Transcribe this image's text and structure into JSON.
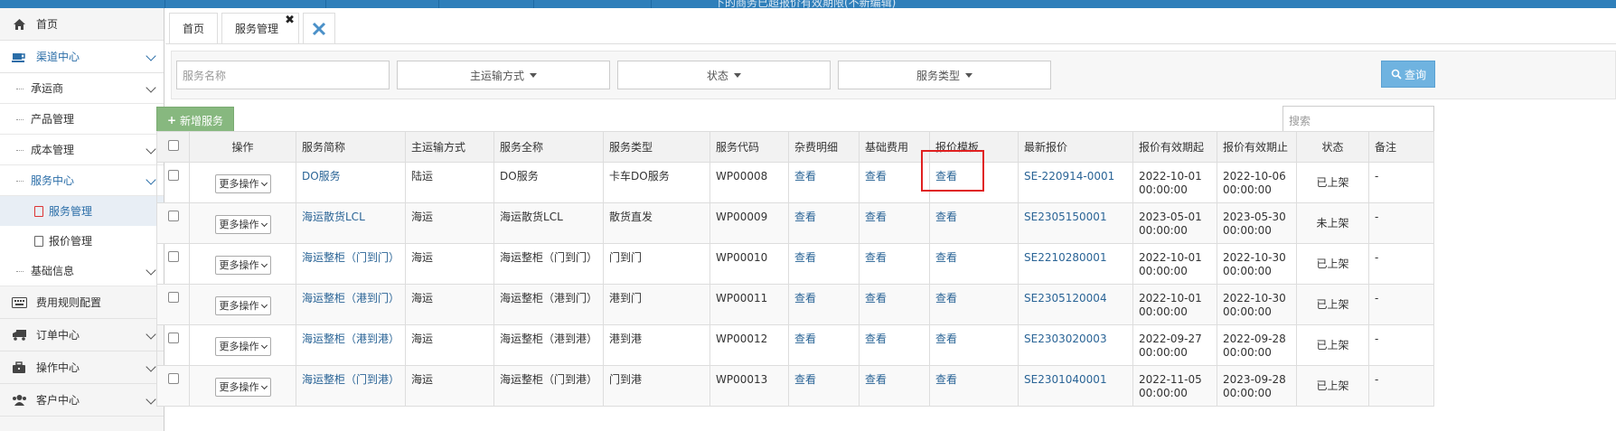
{
  "topbar": {
    "title_fragment": "下的商务已超报价有效期限(不新编辑)"
  },
  "sidebar": {
    "home": "首页",
    "channel_center": "渠道中心",
    "carrier": "承运商",
    "product_mgmt": "产品管理",
    "cost_mgmt": "成本管理",
    "service_center": "服务中心",
    "service_mgmt": "服务管理",
    "quote_mgmt": "报价管理",
    "base_info": "基础信息",
    "fee_rules": "费用规则配置",
    "order_center": "订单中心",
    "ops_center": "操作中心",
    "customer_center": "客户中心"
  },
  "tabs": {
    "home": "首页",
    "service_mgmt": "服务管理",
    "close": "✖"
  },
  "filters": {
    "name_placeholder": "服务名称",
    "transport": "主运输方式",
    "status": "状态",
    "service_type": "服务类型",
    "query_btn": "查询"
  },
  "toolbar": {
    "add_btn": "新增服务",
    "search_placeholder": "搜索"
  },
  "table": {
    "headers": [
      "操作",
      "服务简称",
      "主运输方式",
      "服务全称",
      "服务类型",
      "服务代码",
      "杂费明细",
      "基础费用",
      "报价模板",
      "最新报价",
      "报价有效期起",
      "报价有效期止",
      "状态",
      "备注"
    ],
    "more_ops": "更多操作",
    "view": "查看",
    "rows": [
      {
        "short": "DO服务",
        "transport": "陆运",
        "full": "DO服务",
        "type": "卡车DO服务",
        "code": "WP00008",
        "quote": "SE-220914-0001",
        "from_d": "2022-10-01",
        "from_t": "00:00:00",
        "to_d": "2022-10-06",
        "to_t": "00:00:00",
        "status": "已上架",
        "remark": "-"
      },
      {
        "short": "海运散货LCL",
        "transport": "海运",
        "full": "海运散货LCL",
        "type": "散货直发",
        "code": "WP00009",
        "quote": "SE2305150001",
        "from_d": "2023-05-01",
        "from_t": "00:00:00",
        "to_d": "2023-05-30",
        "to_t": "00:00:00",
        "status": "未上架",
        "remark": "-"
      },
      {
        "short": "海运整柜（门到门）",
        "transport": "海运",
        "full": "海运整柜（门到门）",
        "type": "门到门",
        "code": "WP00010",
        "quote": "SE2210280001",
        "from_d": "2022-10-01",
        "from_t": "00:00:00",
        "to_d": "2022-10-30",
        "to_t": "00:00:00",
        "status": "已上架",
        "remark": "-"
      },
      {
        "short": "海运整柜（港到门）",
        "transport": "海运",
        "full": "海运整柜（港到门）",
        "type": "港到门",
        "code": "WP00011",
        "quote": "SE2305120004",
        "from_d": "2022-10-01",
        "from_t": "00:00:00",
        "to_d": "2022-10-30",
        "to_t": "00:00:00",
        "status": "已上架",
        "remark": "-"
      },
      {
        "short": "海运整柜（港到港）",
        "transport": "海运",
        "full": "海运整柜（港到港）",
        "type": "港到港",
        "code": "WP00012",
        "quote": "SE2303020003",
        "from_d": "2022-09-27",
        "from_t": "00:00:00",
        "to_d": "2022-09-28",
        "to_t": "00:00:00",
        "status": "已上架",
        "remark": "-"
      },
      {
        "short": "海运整柜（门到港）",
        "transport": "海运",
        "full": "海运整柜（门到港）",
        "type": "门到港",
        "code": "WP00013",
        "quote": "SE2301040001",
        "from_d": "2022-11-05",
        "from_t": "00:00:00",
        "to_d": "2023-09-28",
        "to_t": "00:00:00",
        "status": "已上架",
        "remark": "-"
      }
    ]
  },
  "colors": {
    "primary": "#2f7fba",
    "link": "#2a6496",
    "add_button": "#87b87f",
    "query_button": "#6fb3e0",
    "highlight": "#e02020"
  }
}
